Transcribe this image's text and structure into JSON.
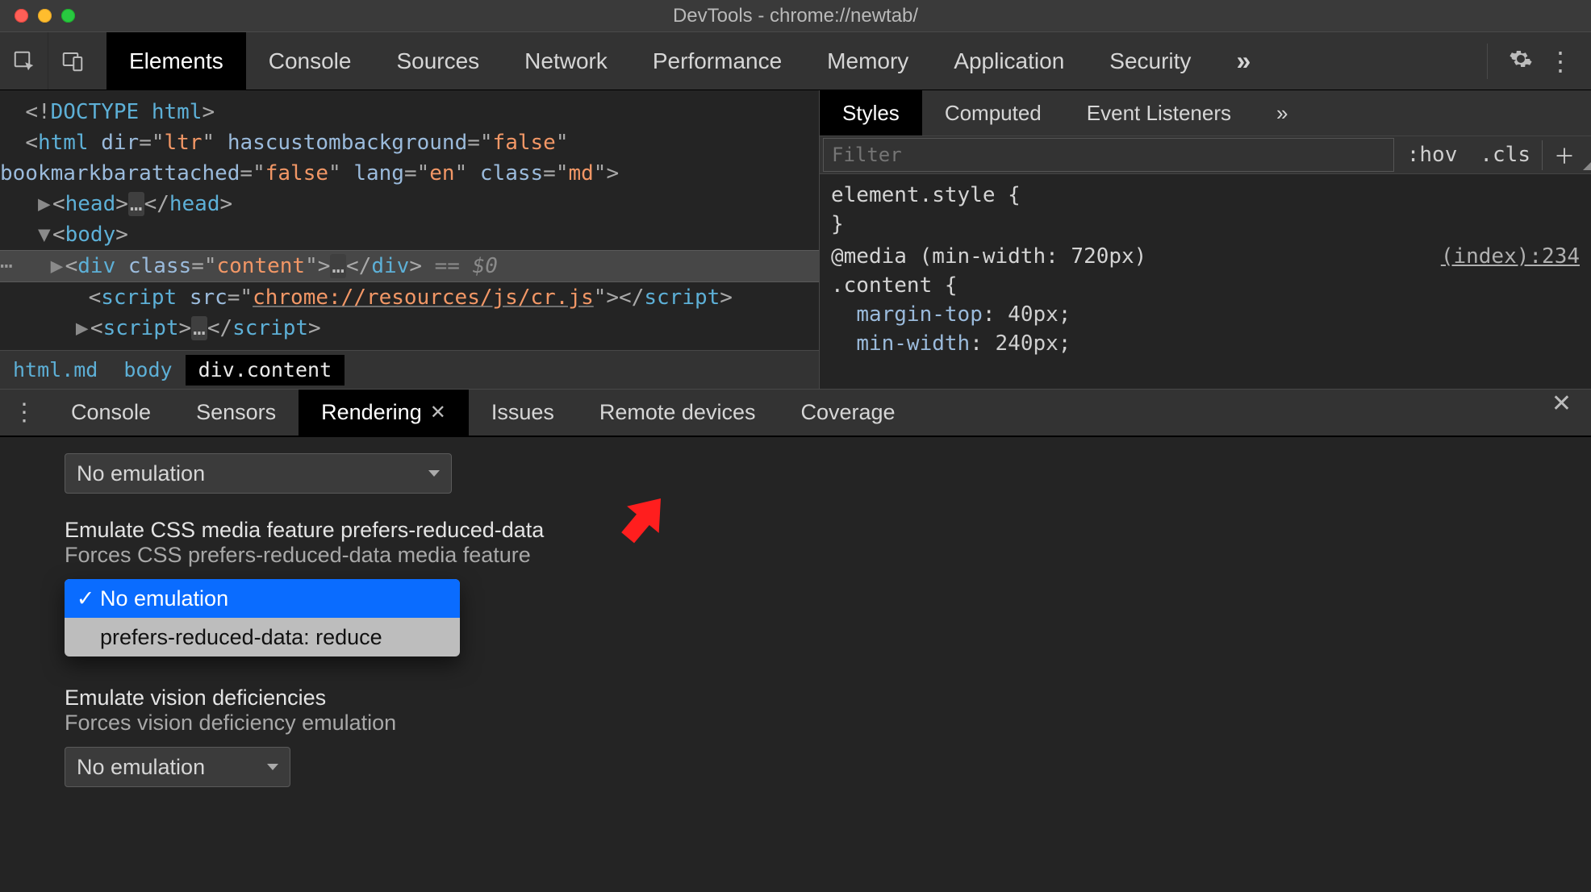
{
  "window": {
    "title": "DevTools - chrome://newtab/"
  },
  "maintabs": {
    "items": [
      "Elements",
      "Console",
      "Sources",
      "Network",
      "Performance",
      "Memory",
      "Application",
      "Security"
    ],
    "active": 0,
    "more_glyph": "»"
  },
  "dom": {
    "doctype": "<!DOCTYPE html>",
    "html_open_1": "<html dir=\"ltr\" hascustombackground=\"false\"",
    "html_open_2": "bookmarkbarattached=\"false\" lang=\"en\" class=\"md\">",
    "head_line": "<head>…</head>",
    "body_open": "<body>",
    "selected_line_text": "<div class=\"content\">…</div>",
    "selected_eq": " == $0",
    "script1": "<script src=\"chrome://resources/js/cr.js\"></script>",
    "script2": "<script>…</script>",
    "crumbs": [
      "html.md",
      "body",
      "div.content"
    ],
    "crumb_active": 2
  },
  "styles": {
    "tabs": [
      "Styles",
      "Computed",
      "Event Listeners"
    ],
    "active": 0,
    "more_glyph": "»",
    "filter_placeholder": "Filter",
    "hov_label": ":hov",
    "cls_label": ".cls",
    "plus_label": "＋",
    "element_style": "element.style {",
    "element_style_close": "}",
    "media_rule": "@media (min-width: 720px)",
    "selector": ".content {",
    "props": [
      {
        "name": "margin-top",
        "value": "40px;"
      },
      {
        "name": "min-width",
        "value": "240px;"
      }
    ],
    "link_label": "(index):234"
  },
  "drawer": {
    "tabs": [
      "Console",
      "Sensors",
      "Rendering",
      "Issues",
      "Remote devices",
      "Coverage"
    ],
    "active": 2,
    "close_glyph": "✕"
  },
  "rendering": {
    "no_emulation": "No emulation",
    "sec1_title": "Emulate CSS media feature prefers-reduced-data",
    "sec1_sub": "Forces CSS prefers-reduced-data media feature",
    "dropdown_options": [
      "No emulation",
      "prefers-reduced-data: reduce"
    ],
    "dropdown_selected": 0,
    "sec2_title": "Emulate vision deficiencies",
    "sec2_sub": "Forces vision deficiency emulation"
  }
}
